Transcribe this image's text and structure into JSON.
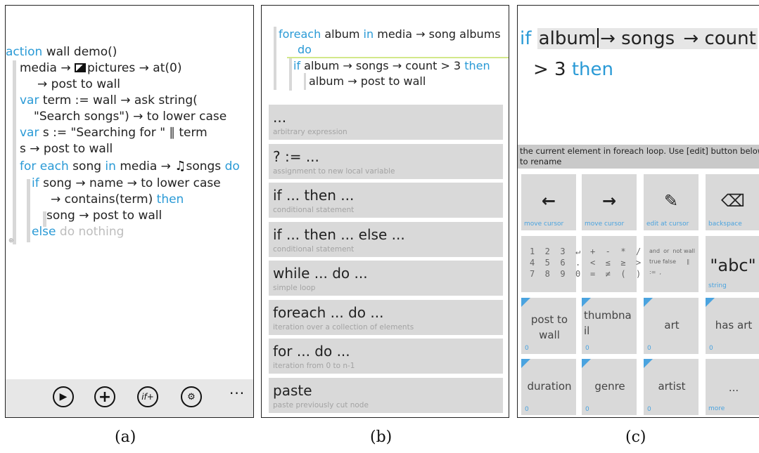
{
  "panel_a": {
    "lines": [
      {
        "kw": "action",
        "text": " wall demo()"
      },
      {
        "pre": "media → ",
        "icon": "pictures",
        "text": "pictures → at(0)"
      },
      {
        "text": "→ post to wall"
      },
      {
        "kw": "var",
        "text": " term := wall → ask string("
      },
      {
        "text": "\"Search songs\") → to lower case"
      },
      {
        "kw": "var",
        "text": " s := \"Searching for \" ∥ term"
      },
      {
        "text": "s → post to wall"
      },
      {
        "kw": "for each",
        "text": " song ",
        "kw2": "in",
        "text2": " media → ",
        "icon": "songs",
        "text3": "songs ",
        "kw3": "do"
      },
      {
        "kw": "if",
        "text": " song → name → to lower case"
      },
      {
        "text": "→ contains(term) ",
        "kw2": "then"
      },
      {
        "text": "song → post to wall"
      },
      {
        "kw": "else",
        "dim": " do nothing"
      }
    ],
    "toolbar": [
      "run",
      "add",
      "if-add",
      "settings"
    ],
    "more": "..."
  },
  "panel_b": {
    "code": [
      {
        "kw": "foreach",
        "text": " album ",
        "kw2": "in",
        "text2": " media → song albums"
      },
      {
        "kw": "do"
      },
      {
        "kw": "if",
        "text": " album → songs → count > 3 ",
        "kw2": "then"
      },
      {
        "text": "album → post to wall"
      }
    ],
    "tiles": [
      {
        "title": "...",
        "desc": "arbitrary expression"
      },
      {
        "title": "? := ...",
        "desc": "assignment to new local variable"
      },
      {
        "title": "if ... then ...",
        "desc": "conditional statement"
      },
      {
        "title": "if ... then ... else ...",
        "desc": "conditional statement"
      },
      {
        "title": "while ... do ...",
        "desc": "simple loop"
      },
      {
        "title": "foreach ... do ...",
        "desc": "iteration over a collection of elements"
      },
      {
        "title": "for ... do ...",
        "desc": "iteration from 0 to n-1"
      },
      {
        "title": "paste",
        "desc": "paste previously cut node"
      }
    ]
  },
  "panel_c": {
    "expr_kw": "if",
    "expr_token1": "album",
    "expr_rest1": "→ songs ",
    "expr_rest2": "→ count",
    "expr_line2": "> 3 ",
    "expr_kw2": "then",
    "hint": "the current element in foreach loop. Use [edit] button below to rename",
    "keys_row1": [
      {
        "glyph": "←",
        "sub": "move cursor"
      },
      {
        "glyph": "→",
        "sub": "move cursor"
      },
      {
        "glyph": "✎",
        "sub": "edit at cursor"
      },
      {
        "glyph": "⌫",
        "sub": "backspace"
      }
    ],
    "keys_row2": [
      {
        "sym": "1  2  3  ↵\n4  5  6  .\n7  8  9  0"
      },
      {
        "sym": "+  -  *  /\n<  ≤  ≥  >\n=  ≠  (  )"
      },
      {
        "sym": "and  or  not wall\ntrue false      ∥\n:=  ,"
      },
      {
        "big": "\"abc\"",
        "sub": "string"
      }
    ],
    "keys_row3": [
      {
        "label": "post to wall",
        "count": "0"
      },
      {
        "label": "thumbnail",
        "count": "0"
      },
      {
        "label": "art",
        "count": "0"
      },
      {
        "label": "has art",
        "count": "0"
      }
    ],
    "keys_row4": [
      {
        "label": "duration",
        "count": "0"
      },
      {
        "label": "genre",
        "count": "0"
      },
      {
        "label": "artist",
        "count": "0"
      },
      {
        "label": "...",
        "sub": "more"
      }
    ]
  },
  "captions": [
    "(a)",
    "(b)",
    "(c)"
  ],
  "colors": {
    "keyword": "#2a9ad6",
    "tile": "#d9d9d9",
    "accent": "#4aa3df",
    "toolbar": "#e7e7e7"
  }
}
